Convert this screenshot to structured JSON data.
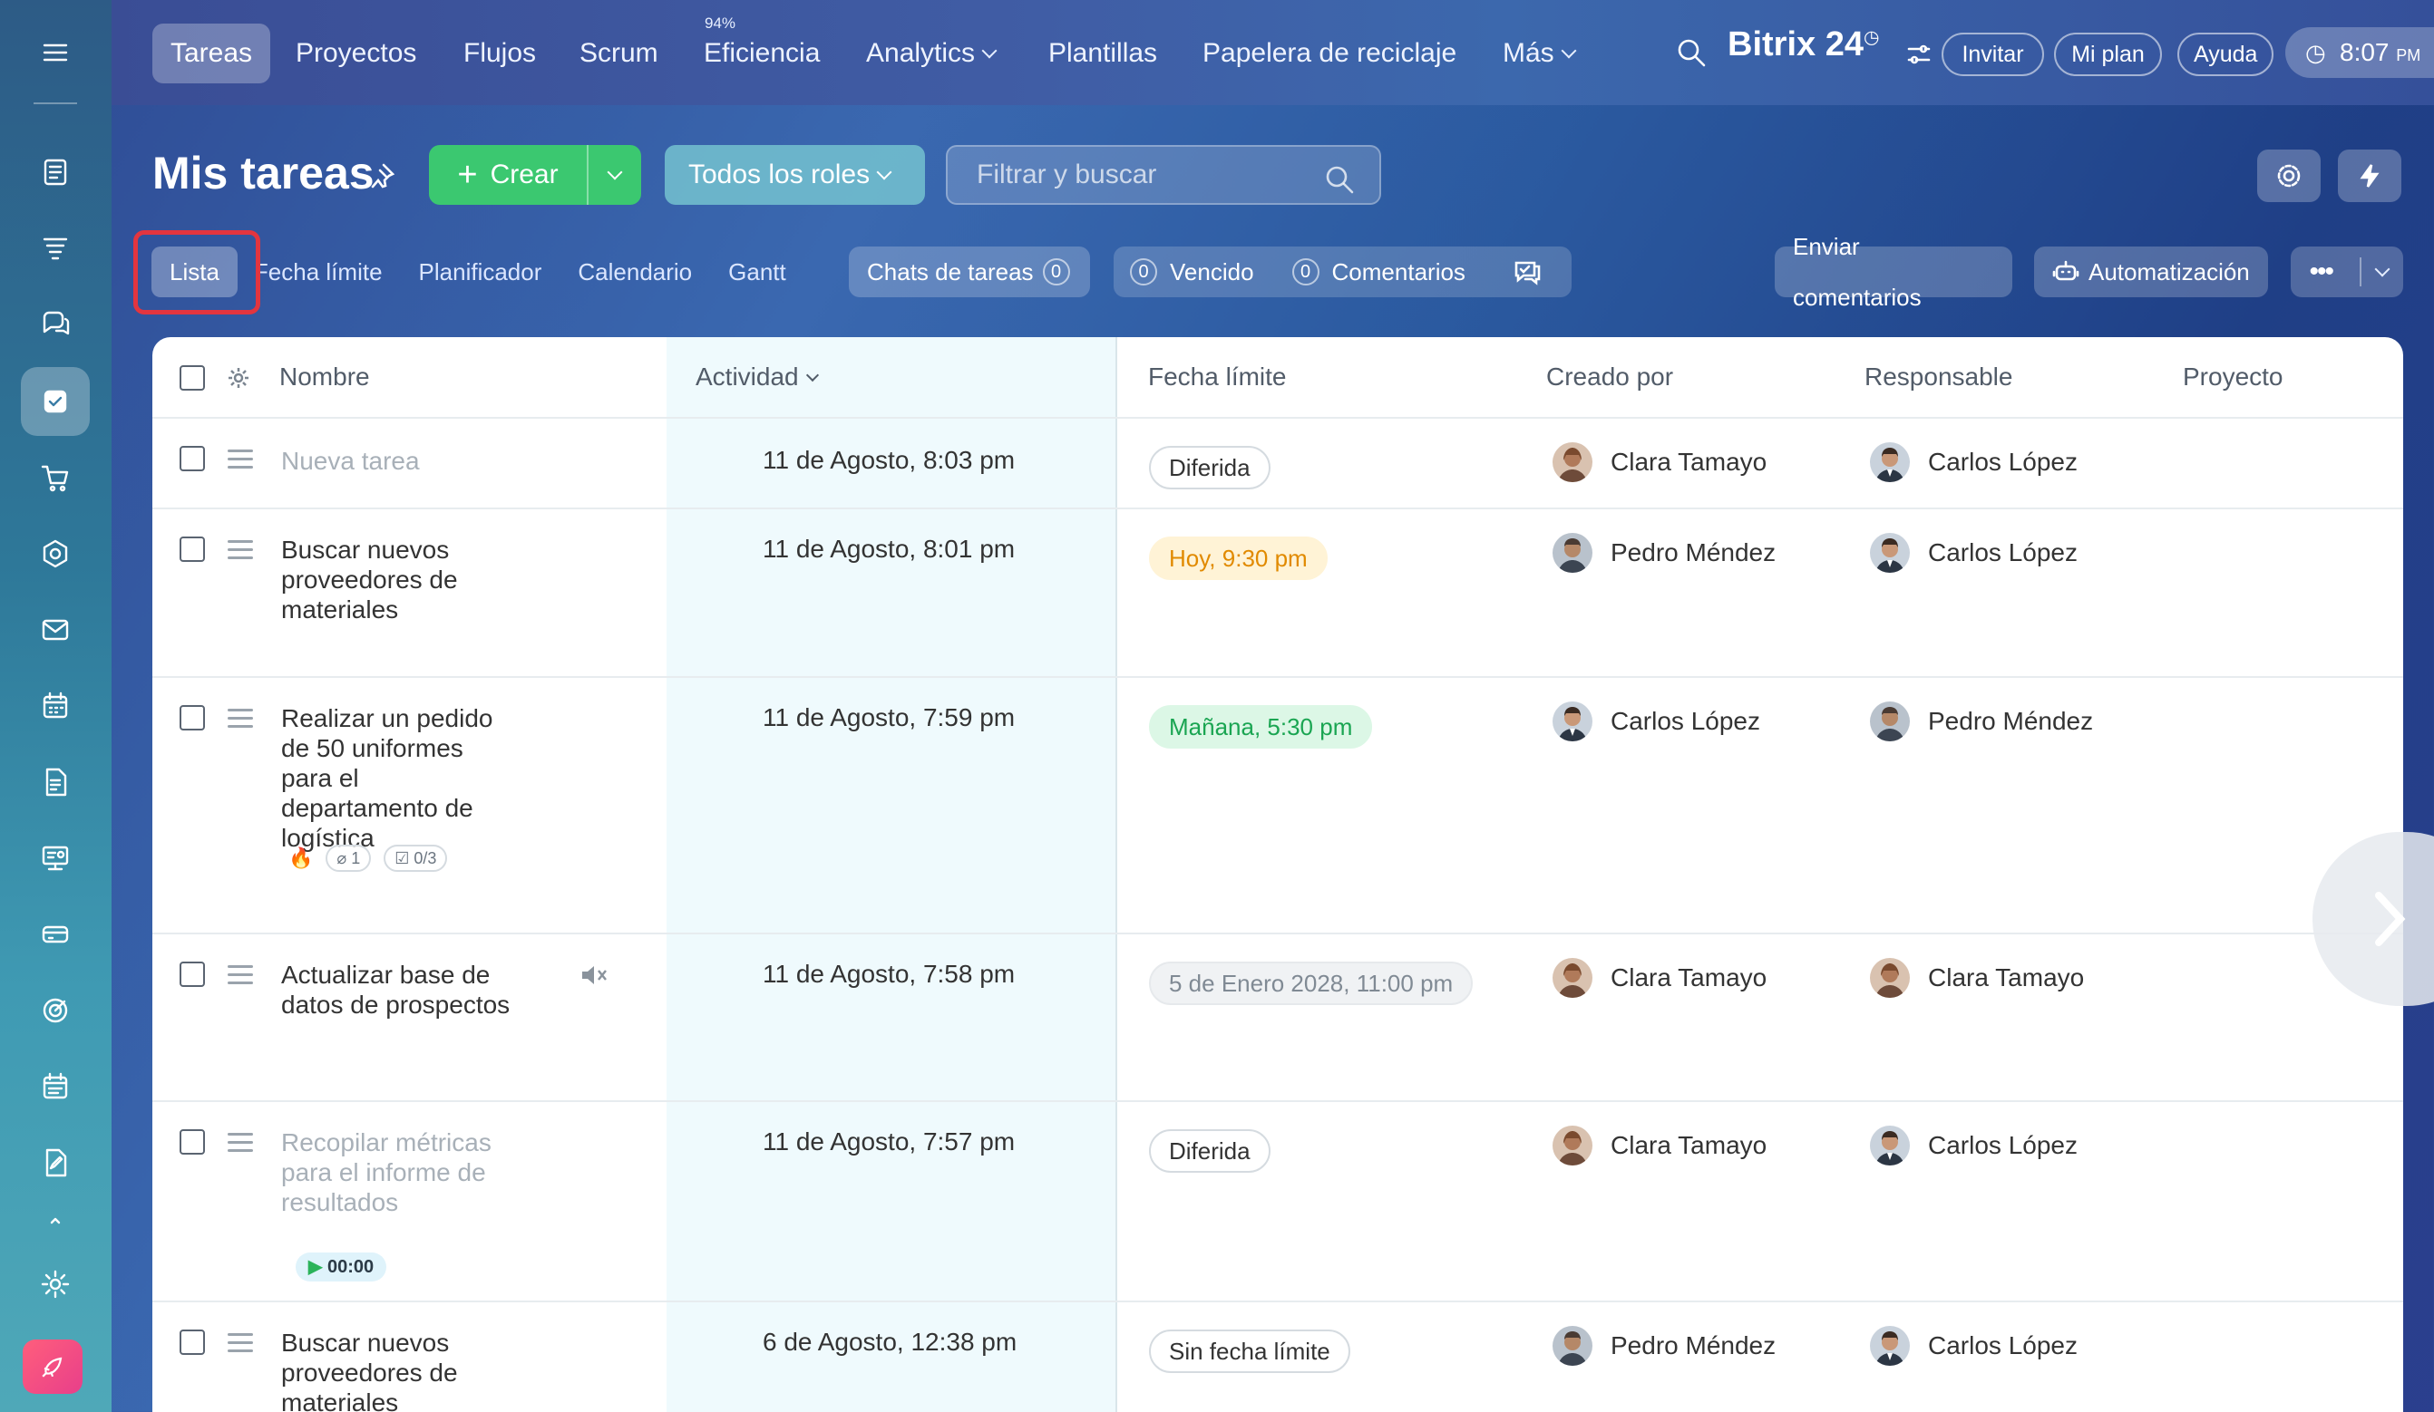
{
  "nav": {
    "items": [
      "Tareas",
      "Proyectos",
      "Flujos",
      "Scrum",
      "Eficiencia",
      "Analytics",
      "Plantillas",
      "Papelera de reciclaje",
      "Más"
    ],
    "efficiency_badge": "94%",
    "brand": "Bitrix 24",
    "invite": "Invitar",
    "plan": "Mi plan",
    "help": "Ayuda",
    "time": "8:07",
    "time_suffix": "PM"
  },
  "header": {
    "title": "Mis tareas",
    "create": "Crear",
    "roles": "Todos los roles",
    "search_placeholder": "Filtrar y buscar"
  },
  "views": {
    "items": [
      "Lista",
      "Fecha límite",
      "Planificador",
      "Calendario",
      "Gantt"
    ],
    "chats": "Chats de tareas",
    "chats_count": "0",
    "overdue": "Vencido",
    "overdue_count": "0",
    "comments": "Comentarios",
    "comments_count": "0",
    "send_feedback": "Enviar comentarios",
    "automation": "Automatización"
  },
  "columns": {
    "name": "Nombre",
    "activity": "Actividad",
    "deadline": "Fecha límite",
    "created_by": "Creado por",
    "responsible": "Responsable",
    "project": "Proyecto"
  },
  "rows": [
    {
      "name": "Nueva tarea",
      "activity": "11 de Agosto, 8:03 pm",
      "deadline": "Diferida",
      "creator": "Clara Tamayo",
      "responsible": "Carlos López"
    },
    {
      "name": "Buscar nuevos proveedores de materiales",
      "activity": "11 de Agosto, 8:01 pm",
      "deadline": "Hoy, 9:30 pm",
      "creator": "Pedro Méndez",
      "responsible": "Carlos López"
    },
    {
      "name": "Realizar un pedido de 50 uniformes para el departamento de logística",
      "activity": "11 de Agosto, 7:59 pm",
      "deadline": "Mañana, 5:30 pm",
      "creator": "Carlos López",
      "responsible": "Pedro Méndez",
      "files": "1",
      "checklist": "0/3"
    },
    {
      "name": "Actualizar base de datos de prospectos",
      "activity": "11 de Agosto, 7:58 pm",
      "deadline": "5 de Enero 2028, 11:00 pm",
      "creator": "Clara Tamayo",
      "responsible": "Clara Tamayo"
    },
    {
      "name": "Recopilar métricas para el informe de resultados",
      "activity": "11 de Agosto, 7:57 pm",
      "deadline": "Diferida",
      "creator": "Clara Tamayo",
      "responsible": "Carlos López",
      "timer": "00:00"
    },
    {
      "name": "Buscar nuevos proveedores de materiales",
      "activity": "6 de Agosto, 12:38 pm",
      "deadline": "Sin fecha límite",
      "creator": "Pedro Méndez",
      "responsible": "Carlos López"
    }
  ],
  "colors": {
    "accent_green": "#3bc870",
    "highlight_red": "#e3353f",
    "today_orange": "#e18a00",
    "tomorrow_green": "#1aa552"
  }
}
